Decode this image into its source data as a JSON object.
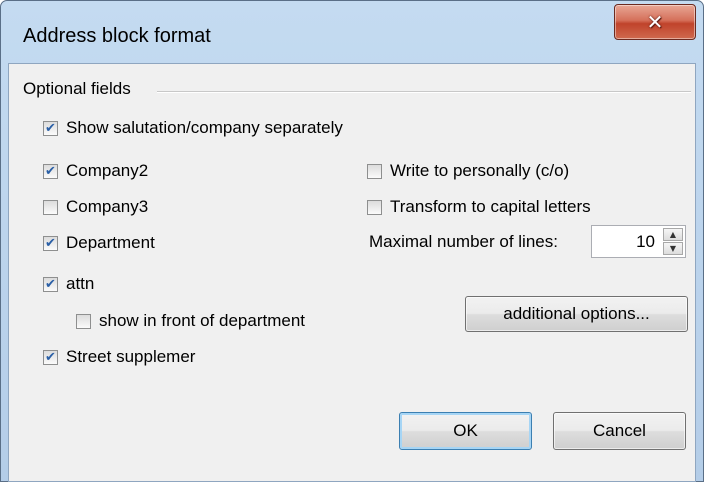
{
  "window": {
    "title": "Address block format",
    "close_glyph": "✕"
  },
  "group": {
    "label": "Optional fields"
  },
  "checkboxes": {
    "show_salutation": {
      "label": "Show salutation/company separately",
      "checked": true
    },
    "company2": {
      "label": "Company2",
      "checked": true
    },
    "company3": {
      "label": "Company3",
      "checked": false
    },
    "department": {
      "label": "Department",
      "checked": true
    },
    "attn": {
      "label": "attn",
      "checked": true
    },
    "show_in_front": {
      "label": "show in front of department",
      "checked": false
    },
    "street_supplement": {
      "label": "Street supplemer",
      "checked": true
    },
    "write_personally": {
      "label": "Write to personally (c/o)",
      "checked": false
    },
    "capital_letters": {
      "label": "Transform to capital letters",
      "checked": false
    }
  },
  "max_lines": {
    "label": "Maximal number of lines:",
    "value": "10",
    "up_glyph": "▲",
    "down_glyph": "▼"
  },
  "buttons": {
    "additional_options": "additional options...",
    "ok": "OK",
    "cancel": "Cancel"
  },
  "check_glyph": "✔",
  "colors": {
    "client_bg": "#f0f0f0",
    "frame": "#c4dbf1",
    "close_red": "#c0432b",
    "check_blue": "#2a5fa6"
  }
}
